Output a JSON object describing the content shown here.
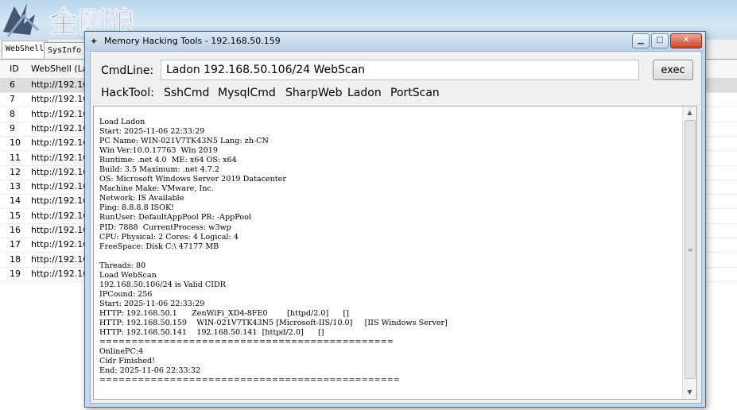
{
  "background_app": {
    "logo_text": "金刚狼",
    "tabs": [
      "WebShell",
      "SysInfo"
    ],
    "table": {
      "columns": [
        "ID",
        "WebShell (La"
      ],
      "rows": [
        {
          "id": "6",
          "url": "http://192.16"
        },
        {
          "id": "7",
          "url": "http://192.16"
        },
        {
          "id": "8",
          "url": "http://192.16"
        },
        {
          "id": "9",
          "url": "http://192.16"
        },
        {
          "id": "10",
          "url": "http://192.16"
        },
        {
          "id": "11",
          "url": "http://192.16"
        },
        {
          "id": "12",
          "url": "http://192.16"
        },
        {
          "id": "13",
          "url": "http://192.16"
        },
        {
          "id": "14",
          "url": "http://192.16"
        },
        {
          "id": "15",
          "url": "http://192.16"
        },
        {
          "id": "16",
          "url": "http://192.16"
        },
        {
          "id": "17",
          "url": "http://192.16"
        },
        {
          "id": "18",
          "url": "http://192.16"
        },
        {
          "id": "19",
          "url": "http://192.16"
        }
      ],
      "selected_row_id": "6"
    }
  },
  "dialog": {
    "title": "Memory Hacking Tools - 192.168.50.159",
    "title_icon": "wolf-app-icon",
    "window_buttons": [
      "minimize",
      "maximize",
      "close"
    ],
    "cmdline_label": "CmdLine:",
    "cmdline_value": "Ladon 192.168.50.106/24 WebScan",
    "exec_label": "exec",
    "hacktool_label": "HackTool:",
    "tools": [
      "SshCmd",
      "MysqlCmd",
      "SharpWeb",
      "Ladon",
      "PortScan"
    ],
    "output": "Load Ladon\nStart: 2025-11-06 22:33:29\nPC Name: WIN-021V7TK43N5 Lang: zh-CN\nWin Ver:10.0.17763  Win 2019\nRuntime: .net 4.0  ME: x64 OS: x64\nBuild: 3.5 Maximum: .net 4.7.2\nOS: Microsoft Windows Server 2019 Datacenter\nMachine Make: VMware, Inc.\nNetwork: IS Available\nPing: 8.8.8.8 ISOK!\nRunUser: DefaultAppPool PR: -AppPool\nPID: 7888  CurrentProcess: w3wp\nCPU: Physical: 2 Cores: 4 Logical: 4\nFreeSpace: Disk C:\\ 47177 MB\n\nThreads: 80\nLoad WebScan\n192.168.50.106/24 is Valid CIDR\nIPCound: 256\nStart: 2025-11-06 22:33:29\nHTTP: 192.168.50.1      ZenWiFi_XD4-8FE0        [httpd/2.0]      []\nHTTP: 192.168.50.159    WIN-021V7TK43N5 [Microsoft-IIS/10.0]     [IIS Windows Server]\nHTTP: 192.168.50.141    192.168.50.141  [httpd/2.0]      []\n==============================================\nOnlinePC:4\nCidr Finished!\nEnd: 2025-11-06 22:33:32\n==============================================="
  }
}
